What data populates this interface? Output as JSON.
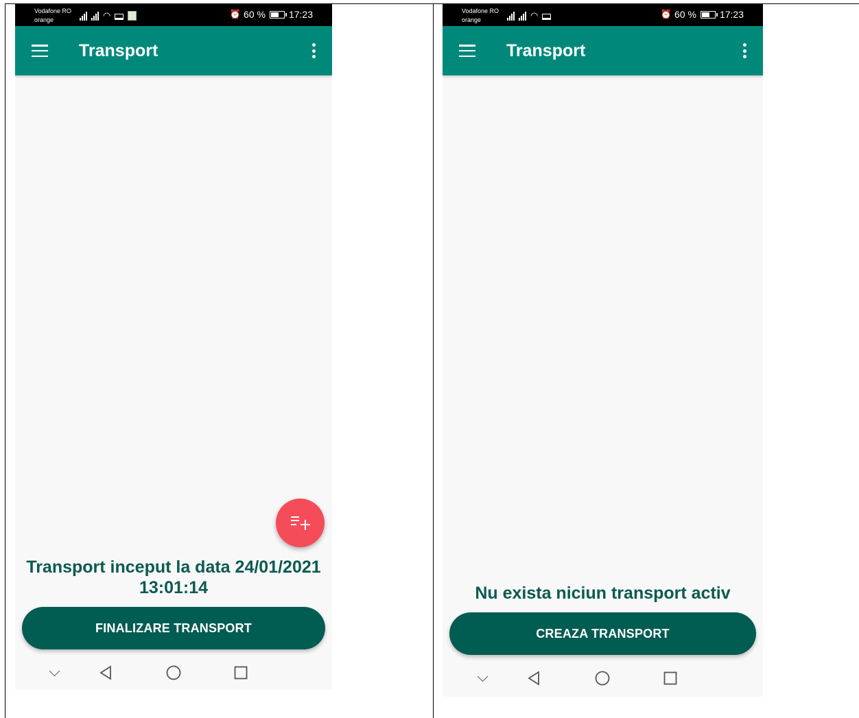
{
  "screens": [
    {
      "status_bar": {
        "carrier_primary": "Vodafone RO",
        "carrier_secondary": "orange",
        "battery": "60 %",
        "time": "17:23"
      },
      "app_bar": {
        "title": "Transport"
      },
      "fab_icon": "playlist-add-icon",
      "status_message": "Transport inceput la data 24/01/2021 13:01:14",
      "action_button": "FINALIZARE TRANSPORT",
      "colors": {
        "app_bar": "#00897b",
        "button": "#015c51",
        "fab": "#f44c58",
        "message_text": "#0b5a51"
      }
    },
    {
      "status_bar": {
        "carrier_primary": "Vodafone RO",
        "carrier_secondary": "orange",
        "battery": "60 %",
        "time": "17:23"
      },
      "app_bar": {
        "title": "Transport"
      },
      "status_message": "Nu exista niciun transport activ",
      "action_button": "CREAZA TRANSPORT",
      "colors": {
        "app_bar": "#00897b",
        "button": "#015c51",
        "message_text": "#0b5a51"
      }
    }
  ]
}
